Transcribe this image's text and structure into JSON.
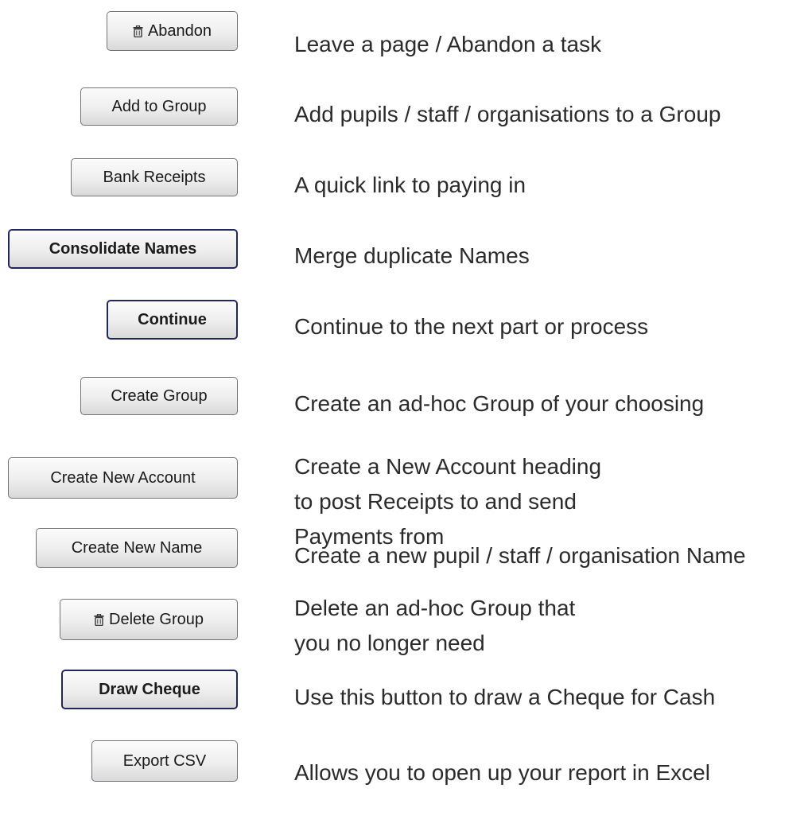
{
  "rows": [
    {
      "button": "Abandon",
      "icon": "trash-icon",
      "description": "Leave a page / Abandon a task"
    },
    {
      "button": "Add to Group",
      "description": "Add pupils / staff / organisations to a Group"
    },
    {
      "button": "Bank Receipts",
      "description": "A quick link to paying in"
    },
    {
      "button": "Consolidate Names",
      "description": "Merge duplicate Names"
    },
    {
      "button": "Continue",
      "description": "Continue to the next part or process"
    },
    {
      "button": "Create Group",
      "description": "Create an ad-hoc Group of your choosing"
    },
    {
      "button": "Create New Account",
      "description": "Create a New Account heading to post Receipts to and send Payments from"
    },
    {
      "button": "Create New Name",
      "description": "Create a new pupil / staff / organisation Name"
    },
    {
      "button": "Delete Group",
      "icon": "trash-icon",
      "description": "Delete an ad-hoc Group that you no longer need"
    },
    {
      "button": "Draw Cheque",
      "description": "Use this button to draw a Cheque for Cash"
    },
    {
      "button": "Export CSV",
      "description": "Allows you to open up your report in Excel"
    }
  ]
}
